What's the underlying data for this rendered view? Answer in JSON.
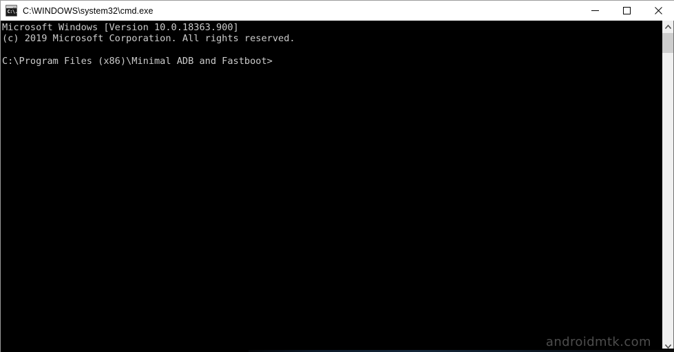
{
  "window": {
    "title": "C:\\WINDOWS\\system32\\cmd.exe",
    "icon": "cmd-prompt-icon",
    "icon_glyph": "C:\\.",
    "titlebar_bg": "#ffffff",
    "titlebar_text_color": "#000000",
    "controls": [
      {
        "name": "minimize",
        "label": "Minimize",
        "glyph": "minimize-icon"
      },
      {
        "name": "maximize",
        "label": "Maximize",
        "glyph": "maximize-icon"
      },
      {
        "name": "close",
        "label": "Close",
        "glyph": "close-icon"
      }
    ]
  },
  "terminal": {
    "background": "#000000",
    "foreground": "#cccccc",
    "lines": [
      "Microsoft Windows [Version 10.0.18363.900]",
      "(c) 2019 Microsoft Corporation. All rights reserved.",
      "",
      "C:\\Program Files (x86)\\Minimal ADB and Fastboot>"
    ],
    "text": "Microsoft Windows [Version 10.0.18363.900]\n(c) 2019 Microsoft Corporation. All rights reserved.\n\nC:\\Program Files (x86)\\Minimal ADB and Fastboot>",
    "prompt": "C:\\Program Files (x86)\\Minimal ADB and Fastboot>",
    "os_banner": "Microsoft Windows [Version 10.0.18363.900]",
    "copyright": "(c) 2019 Microsoft Corporation. All rights reserved.",
    "watermark": "androidmtk.com"
  },
  "scrollbar": {
    "up_arrow": "chevron-up-icon",
    "down_arrow": "chevron-down-icon",
    "track_color": "#f0f0f0",
    "thumb_color": "#cdcdcd"
  }
}
